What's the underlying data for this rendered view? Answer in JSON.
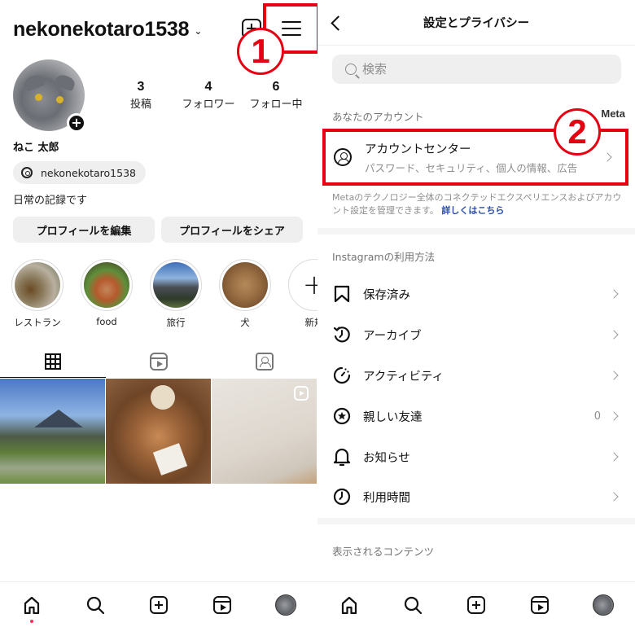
{
  "profile": {
    "username": "nekonekotaro1538",
    "stats": [
      {
        "value": "3",
        "label": "投稿"
      },
      {
        "value": "4",
        "label": "フォロワー"
      },
      {
        "value": "6",
        "label": "フォロー中"
      }
    ],
    "display_name": "ねこ 太郎",
    "threads_handle": "nekonekotaro1538",
    "bio": "日常の記録です",
    "buttons": {
      "edit": "プロフィールを編集",
      "share": "プロフィールをシェア"
    },
    "highlights": [
      {
        "label": "レストラン"
      },
      {
        "label": "food"
      },
      {
        "label": "旅行"
      },
      {
        "label": "犬"
      },
      {
        "label": "新規"
      }
    ],
    "tabs": [
      {
        "name": "grid",
        "active": true
      },
      {
        "name": "reels",
        "active": false
      },
      {
        "name": "tagged",
        "active": false
      }
    ],
    "posts": [
      {
        "type": "photo",
        "subject": "mountain-landscape"
      },
      {
        "type": "photo",
        "subject": "food-plate"
      },
      {
        "type": "reel",
        "subject": "room-corner"
      }
    ]
  },
  "annotations": {
    "step1": "1",
    "step2": "2",
    "color": "#e60012"
  },
  "bottom_nav": {
    "items": [
      "home",
      "search",
      "create",
      "reels",
      "profile"
    ],
    "notification_dot_color": "#ff2d55"
  },
  "settings": {
    "title": "設定とプライバシー",
    "search_placeholder": "検索",
    "your_account_label": "あなたのアカウント",
    "meta_label": "Meta",
    "account_center": {
      "title": "アカウントセンター",
      "subtitle": "パスワード、セキュリティ、個人の情報、広告"
    },
    "account_desc": "Metaのテクノロジー全体のコネクテッドエクスペリエンスおよびアカウント設定を管理できます。",
    "learn_more": "詳しくはこちら",
    "usage_section_label": "Instagramの利用方法",
    "usage_items": [
      {
        "label": "保存済み",
        "icon": "bookmark-icon",
        "count": ""
      },
      {
        "label": "アーカイブ",
        "icon": "archive-icon",
        "count": ""
      },
      {
        "label": "アクティビティ",
        "icon": "activity-icon",
        "count": ""
      },
      {
        "label": "親しい友達",
        "icon": "close-friends-icon",
        "count": "0"
      },
      {
        "label": "お知らせ",
        "icon": "bell-icon",
        "count": ""
      },
      {
        "label": "利用時間",
        "icon": "clock-icon",
        "count": ""
      }
    ],
    "content_section_label": "表示されるコンテンツ"
  }
}
